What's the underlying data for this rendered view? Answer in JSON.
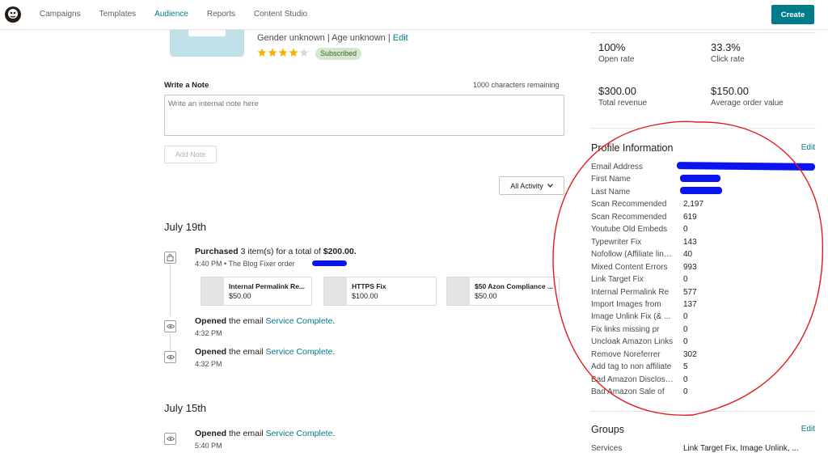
{
  "nav": {
    "items": [
      "Campaigns",
      "Templates",
      "Audience",
      "Reports",
      "Content Studio"
    ],
    "active": "Audience",
    "create_label": "Create"
  },
  "contact": {
    "gender_age": "Gender unknown | Age unknown | ",
    "edit_label": "Edit",
    "rating": 4,
    "rating_max": 5,
    "status": "Subscribed"
  },
  "note": {
    "label": "Write a Note",
    "chars_remaining": "1000 characters remaining",
    "placeholder": "Write an internal note here",
    "add_label": "Add Note"
  },
  "activity_filter": "All Activity",
  "timeline": {
    "date1": "July 19th",
    "purchase": {
      "prefix": "Purchased",
      "mid": " 3 item(s) for a total of ",
      "total": "$200.00.",
      "time": "4:40 PM",
      "store": " • The Blog Fixer order "
    },
    "products": [
      {
        "name": "Internal Permalink Re...",
        "price": "$50.00"
      },
      {
        "name": "HTTPS Fix",
        "price": "$100.00"
      },
      {
        "name": "$50 Azon Compliance ...",
        "price": "$50.00"
      }
    ],
    "opened1": {
      "prefix": "Opened",
      "mid": " the email ",
      "campaign": "Service Complete",
      "suffix": ".",
      "time": "4:32 PM"
    },
    "opened2": {
      "prefix": "Opened",
      "mid": " the email ",
      "campaign": "Service Complete",
      "suffix": ".",
      "time": "4:32 PM"
    },
    "date2": "July 15th",
    "opened3": {
      "prefix": "Opened",
      "mid": " the email ",
      "campaign": "Service Complete",
      "suffix": ".",
      "time": "5:40 PM"
    }
  },
  "stats": {
    "open_rate_value": "100%",
    "open_rate_label": "Open rate",
    "click_rate_value": "33.3%",
    "click_rate_label": "Click rate",
    "revenue_value": "$300.00",
    "revenue_label": "Total revenue",
    "aov_value": "$150.00",
    "aov_label": "Average order value"
  },
  "profile": {
    "title": "Profile Information",
    "edit_label": "Edit",
    "rows": [
      {
        "k": "Email Address",
        "v": ""
      },
      {
        "k": "First Name",
        "v": ""
      },
      {
        "k": "Last Name",
        "v": ""
      },
      {
        "k": "Scan Recommended",
        "v": "2,197"
      },
      {
        "k": "Scan Recommended",
        "v": "619"
      },
      {
        "k": "Youtube Old Embeds",
        "v": "0"
      },
      {
        "k": "Typewriter Fix",
        "v": "143"
      },
      {
        "k": "Nofollow (Affiliate links)",
        "v": "40"
      },
      {
        "k": "Mixed Content Errors",
        "v": "993"
      },
      {
        "k": "Link Target Fix",
        "v": "0"
      },
      {
        "k": "Internal Permalink Re",
        "v": "577"
      },
      {
        "k": "Import Images from",
        "v": "137"
      },
      {
        "k": "Image Unlink Fix (& ...",
        "v": "0"
      },
      {
        "k": "Fix links missing pr",
        "v": "0"
      },
      {
        "k": "Uncloak Amazon Links",
        "v": "0"
      },
      {
        "k": "Remove Noreferrer",
        "v": "302"
      },
      {
        "k": "Add tag to non affiliate",
        "v": "5"
      },
      {
        "k": "Bad Amazon Disclosure",
        "v": "0"
      },
      {
        "k": "Bad Amazon Sale of",
        "v": "0"
      }
    ]
  },
  "groups": {
    "title": "Groups",
    "edit_label": "Edit",
    "services_label": "Services",
    "services_value": "Link Target Fix, Image Unlink, ..."
  },
  "colors": {
    "brand": "#007c89",
    "subscribed_bg": "#d3e8cc",
    "star": "#f2b300",
    "annotation": "#e31b1b",
    "redaction": "#0a14ee"
  }
}
